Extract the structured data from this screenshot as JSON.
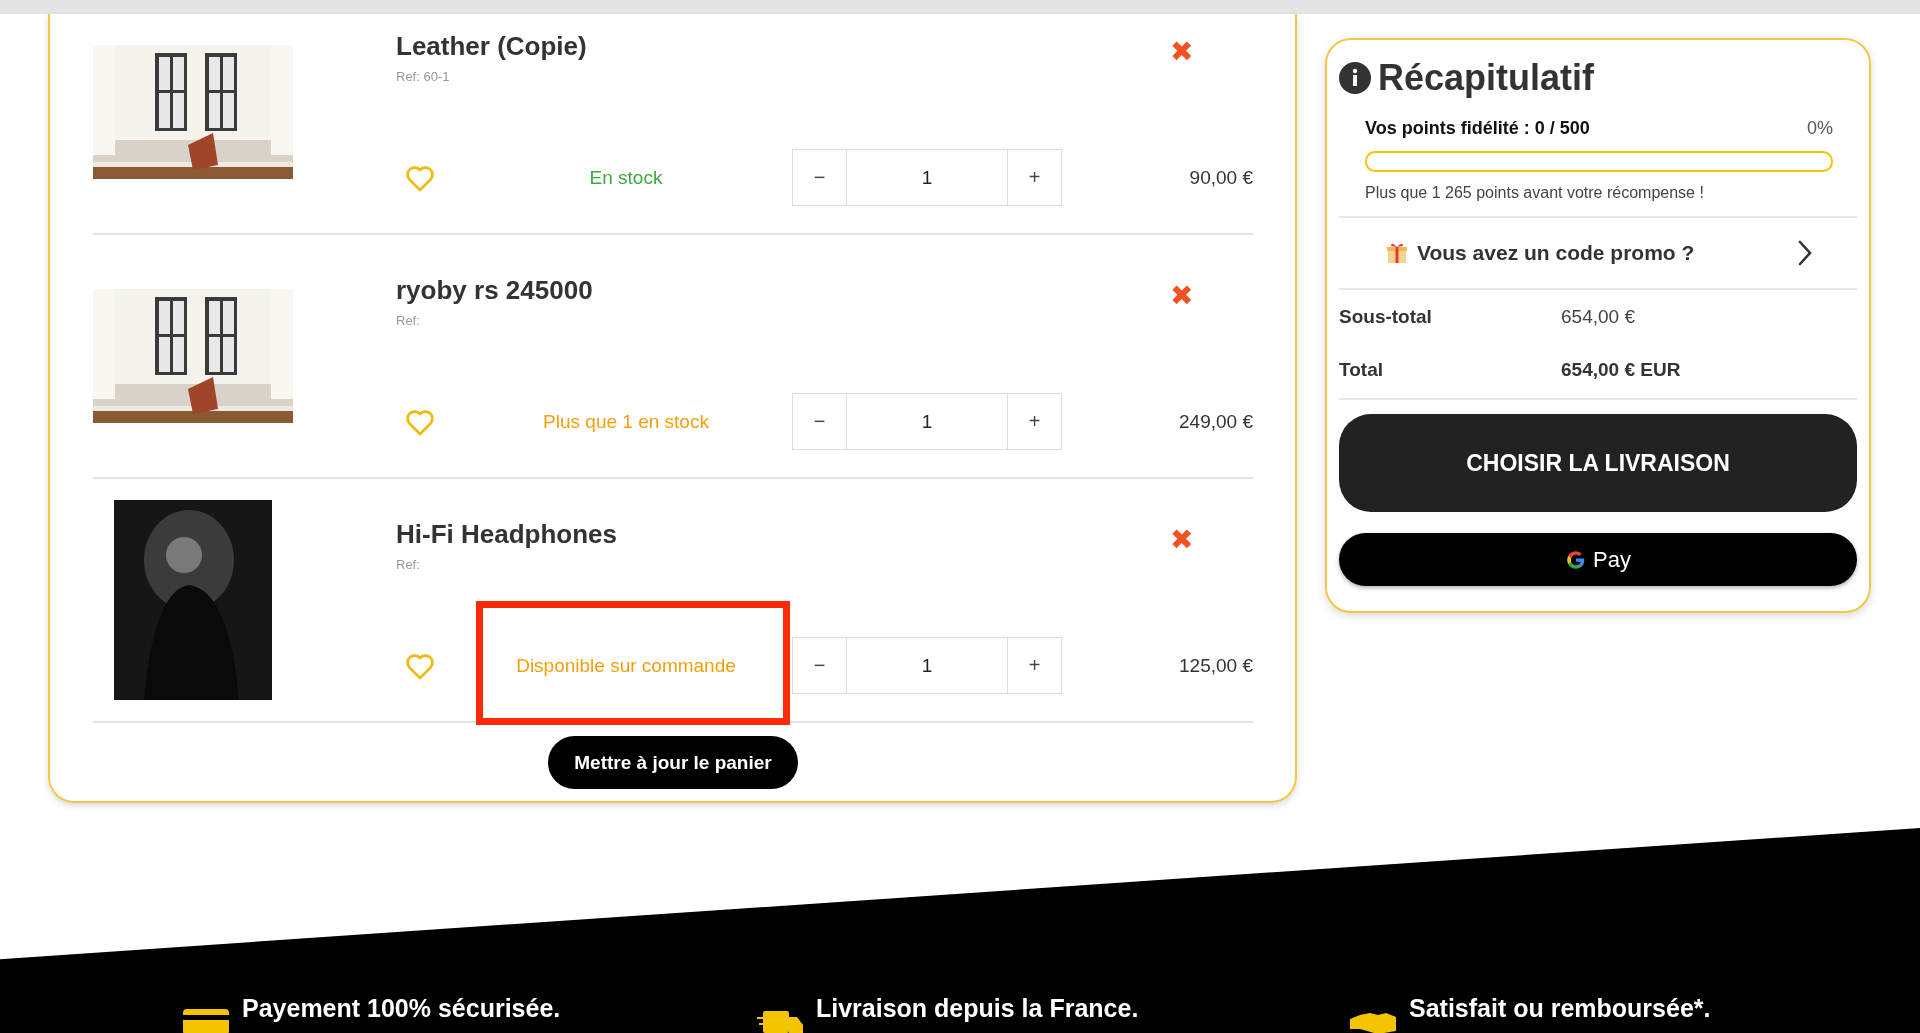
{
  "cart_items": [
    {
      "name": "Leather (Copie)",
      "ref": "Ref: 60-1",
      "kind": "room",
      "stock": "En stock",
      "color": "#3bab3b",
      "highlighted": false,
      "minus": "−",
      "quantity": "1",
      "plus": "+",
      "price": "90,00 €",
      "remove": "✖"
    },
    {
      "name": "ryoby rs 245000",
      "ref": "Ref:",
      "kind": "room",
      "stock": "Plus que 1 en stock",
      "color": "#f59e0b",
      "highlighted": false,
      "minus": "−",
      "quantity": "1",
      "plus": "+",
      "price": "249,00 €",
      "remove": "✖"
    },
    {
      "name": "Hi-Fi Headphones",
      "ref": "Ref:",
      "kind": "portrait",
      "stock": "Disponible sur commande",
      "color": "#f59e0b",
      "highlighted": true,
      "minus": "−",
      "quantity": "1",
      "plus": "+",
      "price": "125,00 €",
      "remove": "✖"
    }
  ],
  "update_button": "Mettre à jour le panier",
  "summary": {
    "title": "Récapitulatif",
    "loyalty_label": "Vos points fidélité : 0 / 500",
    "loyalty_percent": "0%",
    "level": 0,
    "loyalty_note": "Plus que 1 265 points avant votre récompense !",
    "promo": "Vous avez un code promo ?",
    "subtotal_label": "Sous-total",
    "subtotal": "654,00 €",
    "total_label": "Total",
    "total": "654,00 € EUR",
    "checkout_button": "CHOISIR LA LIVRAISON",
    "gpay_button": "Pay"
  },
  "footer_features": [
    {
      "kind": "card",
      "text": "Payement 100% sécurisée."
    },
    {
      "kind": "truck",
      "text": "Livraison depuis la France."
    },
    {
      "kind": "handshake",
      "text": "Satisfait ou remboursée*."
    }
  ]
}
